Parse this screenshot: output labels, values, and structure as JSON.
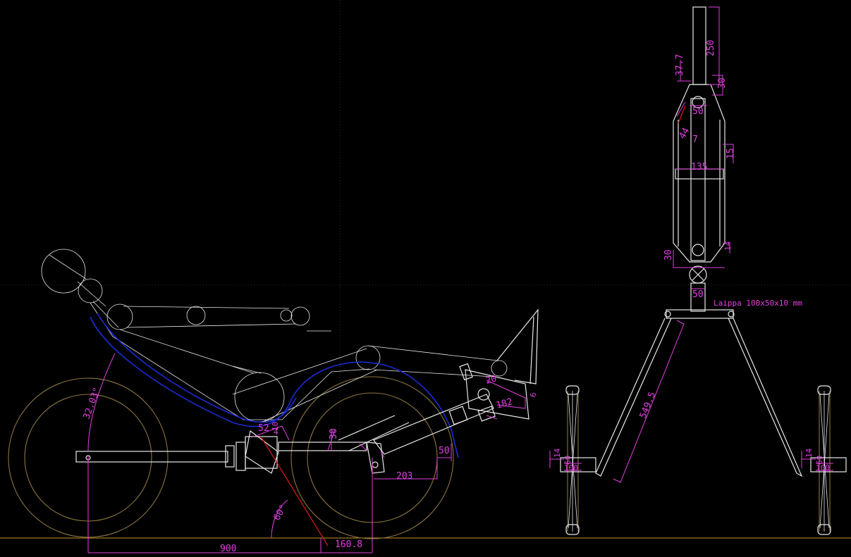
{
  "colors": {
    "background": "#000000",
    "geometry": "#e8e8e8",
    "dimension": "#e040e0",
    "chain_line": "#1a2cd8",
    "wheel": "#8a7440",
    "steering_axis": "#e01818"
  },
  "side_view": {
    "angle_seat": "32.03°",
    "angle_head": "60°",
    "dim_wheelbase": "900",
    "dim_trail": "160.8",
    "dim_203": "203",
    "dim_50": "50",
    "dim_30": "30",
    "dim_52": "52",
    "dim_10": "10",
    "dim_4": "4",
    "dim_182": "182",
    "dim_20": "20",
    "dim_6": "6"
  },
  "front_view": {
    "dim_250": "250",
    "dim_37_7": "37.7",
    "dim_30_top": "30",
    "dim_50_top": "50",
    "dim_44": "44",
    "dim_7": "7",
    "dim_15": "15",
    "dim_135": "135",
    "dim_30_bottom": "30",
    "dim_14": "14",
    "dim_50_bottom": "50",
    "note_flange": "Laippa 100x50x10 mm",
    "dim_549_5": "549.5"
  },
  "wheel_detail": {
    "dim_14": "14",
    "dim_60": "60",
    "dim_100": "100"
  }
}
